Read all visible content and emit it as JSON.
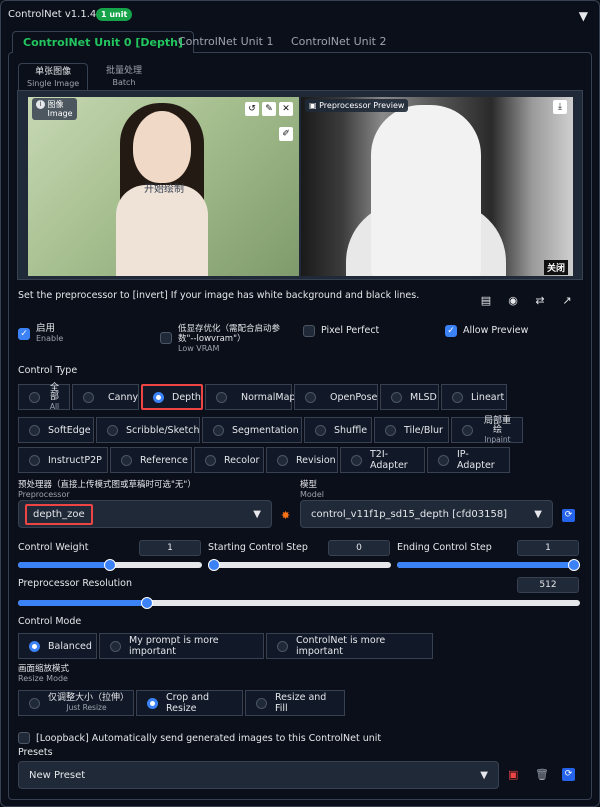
{
  "header": {
    "title": "ControlNet v1.1.410",
    "badge": "1 unit",
    "collapse_glyph": "▼"
  },
  "unit_tabs": [
    "ControlNet Unit 0 [Depth]",
    "ControlNet Unit 1",
    "ControlNet Unit 2"
  ],
  "image_tabs": [
    {
      "label": "单张图像",
      "sub": "Single Image"
    },
    {
      "label": "批量处理",
      "sub": "Batch"
    }
  ],
  "image_panel": {
    "label": "图像",
    "label_sub": "Image",
    "center_text": "开始绘制",
    "preview_label": "Preprocessor Preview",
    "close_label": "关闭"
  },
  "help_text": "Set the preprocessor to [invert] If your image has white background and black lines.",
  "checkboxes": {
    "enable": {
      "label": "启用",
      "sub": "Enable",
      "checked": true
    },
    "low_vram": {
      "label": "低显存优化（需配合启动参数\"--lowvram\"）",
      "sub": "Low VRAM",
      "checked": false
    },
    "pixel_perfect": {
      "label": "Pixel Perfect",
      "checked": false
    },
    "allow_preview": {
      "label": "Allow Preview",
      "checked": true
    }
  },
  "control_type": {
    "label": "Control Type",
    "selected": "Depth",
    "row1": [
      {
        "label": "全部",
        "sub": "All"
      },
      {
        "label": "Canny"
      },
      {
        "label": "Depth"
      },
      {
        "label": "NormalMap"
      },
      {
        "label": "OpenPose"
      },
      {
        "label": "MLSD"
      },
      {
        "label": "Lineart"
      }
    ],
    "row2": [
      {
        "label": "SoftEdge"
      },
      {
        "label": "Scribble/Sketch"
      },
      {
        "label": "Segmentation"
      },
      {
        "label": "Shuffle"
      },
      {
        "label": "Tile/Blur"
      },
      {
        "label": "局部重绘",
        "sub": "Inpaint"
      }
    ],
    "row3": [
      {
        "label": "InstructP2P"
      },
      {
        "label": "Reference"
      },
      {
        "label": "Recolor"
      },
      {
        "label": "Revision"
      },
      {
        "label": "T2I-Adapter"
      },
      {
        "label": "IP-Adapter"
      }
    ]
  },
  "preprocessor": {
    "label": "预处理器（直接上传模式图或草稿时可选\"无\"）",
    "sub": "Preprocessor",
    "value": "depth_zoe"
  },
  "model": {
    "label": "模型",
    "sub": "Model",
    "value": "control_v11f1p_sd15_depth [cfd03158]"
  },
  "sliders": {
    "control_weight": {
      "label": "Control Weight",
      "value": "1",
      "fraction": 0.5
    },
    "starting_step": {
      "label": "Starting Control Step",
      "value": "0",
      "fraction": 0.0
    },
    "ending_step": {
      "label": "Ending Control Step",
      "value": "1",
      "fraction": 1.0
    },
    "preprocessor_resolution": {
      "label": "Preprocessor Resolution",
      "value": "512",
      "fraction": 0.23
    }
  },
  "control_mode": {
    "label": "Control Mode",
    "options": [
      "Balanced",
      "My prompt is more important",
      "ControlNet is more important"
    ],
    "selected": "Balanced"
  },
  "resize_mode": {
    "label": "画面缩放模式",
    "sub": "Resize Mode",
    "options": [
      {
        "label": "仅调整大小（拉伸）",
        "sub": "Just Resize"
      },
      {
        "label": "Crop and Resize"
      },
      {
        "label": "Resize and Fill"
      }
    ],
    "selected": "Crop and Resize"
  },
  "loopback": {
    "label": "[Loopback] Automatically send generated images to this ControlNet unit",
    "checked": false
  },
  "presets": {
    "label": "Presets",
    "value": "New Preset"
  }
}
